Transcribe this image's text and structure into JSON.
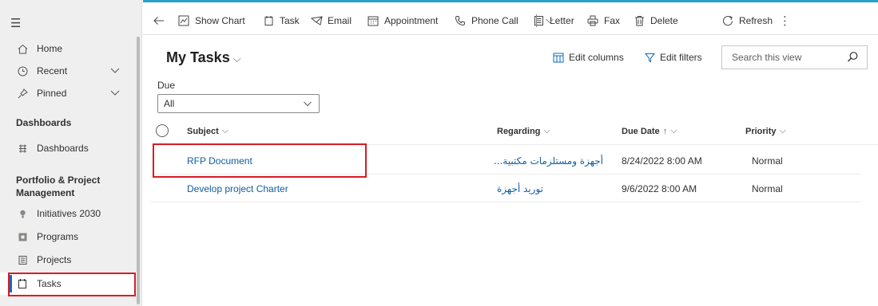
{
  "sidebar": {
    "items": [
      {
        "label": "Home",
        "icon": "home-icon"
      },
      {
        "label": "Recent",
        "icon": "clock-icon",
        "expandable": true
      },
      {
        "label": "Pinned",
        "icon": "pin-icon",
        "expandable": true
      }
    ],
    "groups": [
      {
        "title": "Dashboards",
        "items": [
          {
            "label": "Dashboards",
            "icon": "dashboard-icon"
          }
        ]
      },
      {
        "title": "Portfolio & Project Management",
        "items": [
          {
            "label": "Initiatives 2030",
            "icon": "lightbulb-icon"
          },
          {
            "label": "Programs",
            "icon": "programs-icon"
          },
          {
            "label": "Projects",
            "icon": "projects-icon"
          },
          {
            "label": "Tasks",
            "icon": "tasks-icon",
            "selected": true
          }
        ]
      }
    ]
  },
  "commandbar": {
    "back": "back-arrow-icon",
    "show_chart": "Show Chart",
    "task": "Task",
    "email": "Email",
    "appointment": "Appointment",
    "phone_call": "Phone Call",
    "letter": "Letter",
    "fax": "Fax",
    "delete": "Delete",
    "refresh": "Refresh",
    "more": "⋮"
  },
  "view": {
    "title": "My Tasks",
    "edit_columns": "Edit columns",
    "edit_filters": "Edit filters",
    "search_placeholder": "Search this view"
  },
  "filter": {
    "label": "Due",
    "value": "All"
  },
  "grid": {
    "columns": {
      "subject": "Subject",
      "regarding": "Regarding",
      "due_date": "Due Date",
      "priority": "Priority"
    },
    "rows": [
      {
        "subject": "RFP Document",
        "regarding": "أجهزة ومستلزمات مكتبية...",
        "due_date": "8/24/2022 8:00 AM",
        "priority": "Normal"
      },
      {
        "subject": "Develop project Charter",
        "regarding": "توريد أجهزة",
        "due_date": "9/6/2022 8:00 AM",
        "priority": "Normal"
      }
    ]
  },
  "colors": {
    "accent_blue": "#115ea3",
    "highlight_red": "#d71c25",
    "top_border": "#2aa1c8",
    "sidebar_bg": "#efefef"
  }
}
